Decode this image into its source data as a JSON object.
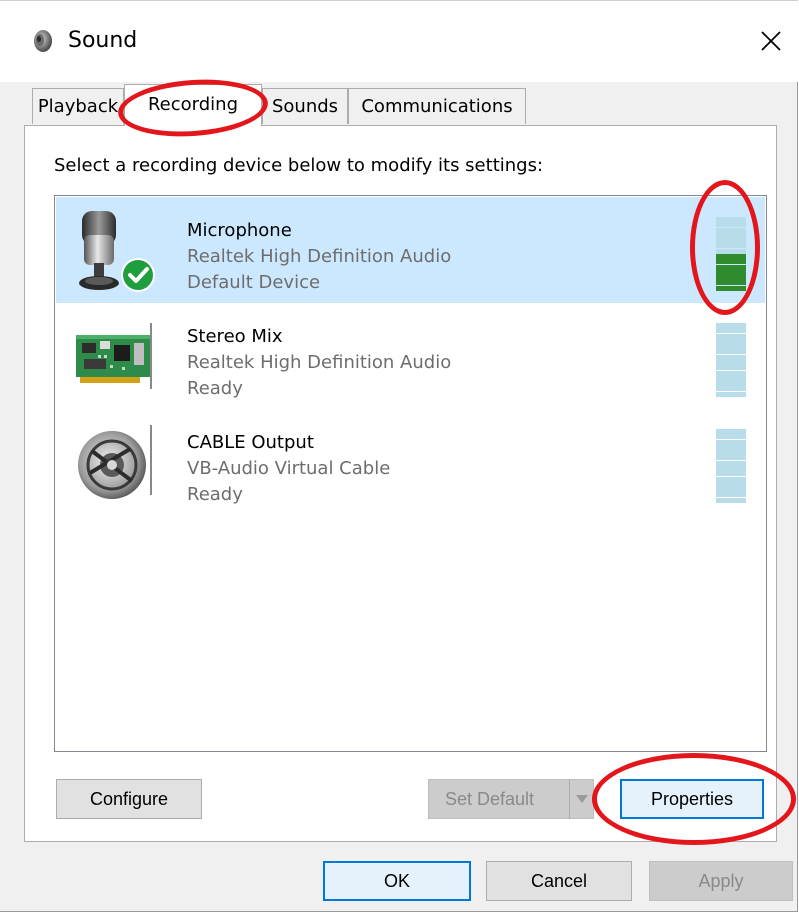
{
  "window": {
    "title": "Sound",
    "icon": "speaker-icon",
    "close_glyph": "✕"
  },
  "tabs": [
    {
      "label": "Playback",
      "active": false
    },
    {
      "label": "Recording",
      "active": true
    },
    {
      "label": "Sounds",
      "active": false
    },
    {
      "label": "Communications",
      "active": false
    }
  ],
  "instruction": "Select a recording device below to modify its settings:",
  "devices": [
    {
      "name": "Microphone",
      "driver": "Realtek High Definition Audio",
      "status": "Default Device",
      "selected": true,
      "is_default": true,
      "icon": "microphone-icon",
      "level_bars": 7
    },
    {
      "name": "Stereo Mix",
      "driver": "Realtek High Definition Audio",
      "status": "Ready",
      "selected": false,
      "is_default": false,
      "icon": "sound-card-icon",
      "level_bars": 0
    },
    {
      "name": "CABLE Output",
      "driver": "VB-Audio Virtual Cable",
      "status": "Ready",
      "selected": false,
      "is_default": false,
      "icon": "cable-icon",
      "level_bars": 0
    }
  ],
  "meter": {
    "total_segments": 14,
    "active_color": "#2e8b2e",
    "inactive_color": "#b8dcea"
  },
  "buttons": {
    "configure": "Configure",
    "set_default": "Set Default",
    "properties": "Properties",
    "ok": "OK",
    "cancel": "Cancel",
    "apply": "Apply"
  },
  "colors": {
    "selection": "#cce8ff",
    "focus_border": "#0078d7",
    "default_check": "#1e9e3c",
    "annotation": "#e3161b"
  }
}
